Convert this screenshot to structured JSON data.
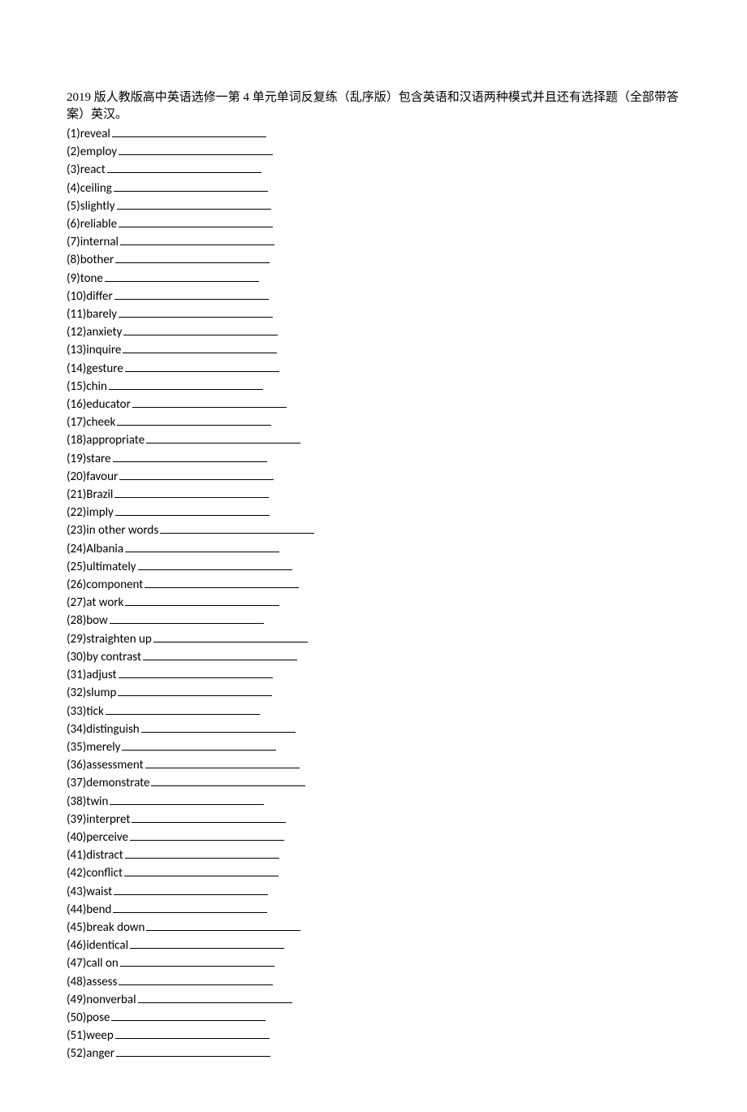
{
  "title": "2019 版人教版高中英语选修一第 4 单元单词反复练（乱序版）包含英语和汉语两种模式并且还有选择题（全部带答案）英汉。",
  "words": [
    "reveal",
    "employ",
    "react",
    "ceiling",
    "slightly",
    "reliable",
    "internal",
    "bother",
    "tone",
    "differ",
    "barely",
    "anxiety",
    "inquire",
    "gesture",
    "chin",
    "educator",
    "cheek",
    "appropriate",
    "stare",
    "favour",
    "Brazil",
    "imply",
    "in other words",
    "Albania",
    "ultimately",
    "component",
    "at work",
    "bow",
    "straighten up",
    "by contrast",
    "adjust",
    "slump",
    "tick",
    "distinguish",
    "merely",
    "assessment",
    "demonstrate",
    "twin",
    "interpret",
    "perceive",
    "distract",
    "conflict",
    "waist",
    "bend",
    "break down",
    "identical",
    "call on",
    "assess",
    "nonverbal",
    "pose",
    "weep",
    "anger"
  ]
}
